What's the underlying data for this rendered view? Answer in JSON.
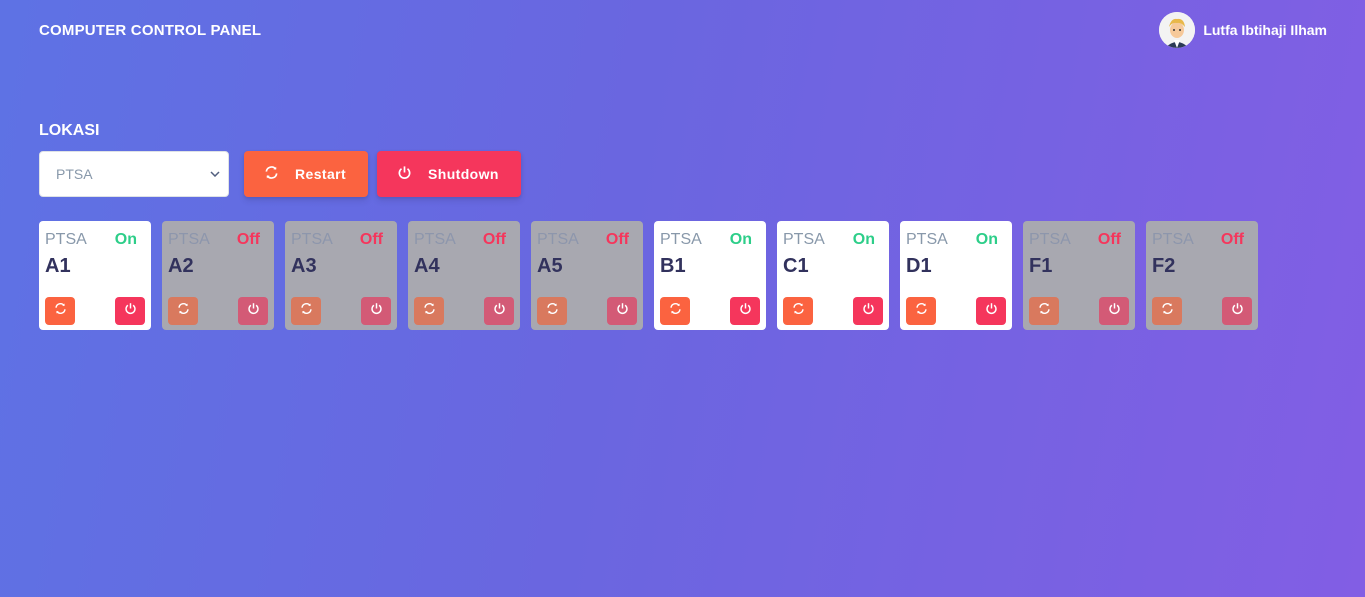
{
  "header": {
    "title": "COMPUTER CONTROL PANEL",
    "user_name": "Lutfa Ibtihaji Ilham"
  },
  "location": {
    "label": "LOKASI",
    "selected": "PTSA",
    "restart_label": "Restart",
    "shutdown_label": "Shutdown"
  },
  "computers": [
    {
      "location": "PTSA",
      "name": "A1",
      "status": "On"
    },
    {
      "location": "PTSA",
      "name": "A2",
      "status": "Off"
    },
    {
      "location": "PTSA",
      "name": "A3",
      "status": "Off"
    },
    {
      "location": "PTSA",
      "name": "A4",
      "status": "Off"
    },
    {
      "location": "PTSA",
      "name": "A5",
      "status": "Off"
    },
    {
      "location": "PTSA",
      "name": "B1",
      "status": "On"
    },
    {
      "location": "PTSA",
      "name": "C1",
      "status": "On"
    },
    {
      "location": "PTSA",
      "name": "D1",
      "status": "On"
    },
    {
      "location": "PTSA",
      "name": "F1",
      "status": "Off"
    },
    {
      "location": "PTSA",
      "name": "F2",
      "status": "Off"
    }
  ],
  "icons": {
    "restart": "refresh-icon",
    "shutdown": "power-icon",
    "user": "avatar"
  },
  "colors": {
    "on": "#2dce89",
    "off": "#f5365c",
    "restart": "#fb6340",
    "shutdown": "#f5365c"
  }
}
